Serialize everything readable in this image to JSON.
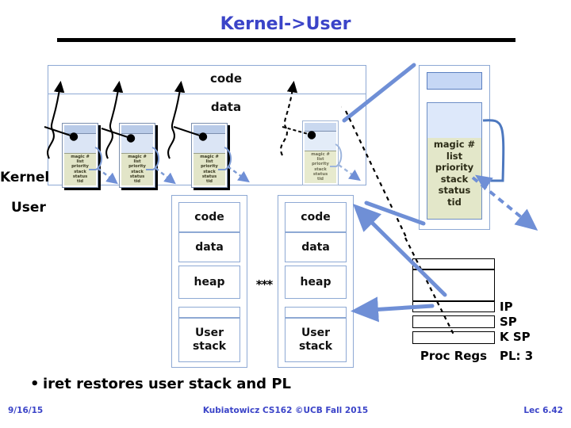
{
  "slide": {
    "title": "Kernel->User",
    "bullet": "iret restores user stack and PL",
    "bullet_marker": "•"
  },
  "kernel_region": {
    "label": "Kernel",
    "code_label": "code",
    "data_label": "data",
    "thread_blocks": [
      {
        "fields": "magic #\nlist\npriority\nstack\nstatus\ntid"
      },
      {
        "fields": "magic #\nlist\npriority\nstack\nstatus\ntid"
      },
      {
        "fields": "magic #\nlist\npriority\nstack\nstatus\ntid"
      },
      {
        "fields": "magic #\nlist\npriority\nstack\nstatus\ntid"
      }
    ]
  },
  "magnified_tcb": {
    "fields": [
      "magic  #",
      "list",
      "priority",
      "stack",
      "status",
      "tid"
    ]
  },
  "user_region": {
    "label": "User",
    "ellipsis": "***",
    "processes": [
      {
        "segments": [
          {
            "name": "code",
            "label": "code"
          },
          {
            "name": "data",
            "label": "data"
          },
          {
            "name": "heap",
            "label": "heap"
          },
          {
            "name": "gap",
            "label": ""
          },
          {
            "name": "user-stack",
            "line1": "User",
            "line2": "stack"
          }
        ]
      },
      {
        "segments": [
          {
            "name": "code",
            "label": "code"
          },
          {
            "name": "data",
            "label": "data"
          },
          {
            "name": "heap",
            "label": "heap"
          },
          {
            "name": "gap",
            "label": ""
          },
          {
            "name": "user-stack",
            "line1": "User",
            "line2": "stack"
          }
        ]
      }
    ]
  },
  "proc_regs": {
    "caption": "Proc Regs",
    "labels": [
      "IP",
      "SP",
      "K SP"
    ],
    "pl": "PL: 3"
  },
  "footer": {
    "date": "9/16/15",
    "center": "Kubiatowicz CS162 ©UCB Fall 2015",
    "lecture": "Lec 6.42"
  },
  "colors": {
    "title_blue": "#3b44c8",
    "arrow_blue": "#6f8fd6",
    "box_border_blue": "#8ea9d4",
    "tcb_field_olive": "#e2e5c8",
    "tcb_header_blue": "#b9cbe8"
  }
}
